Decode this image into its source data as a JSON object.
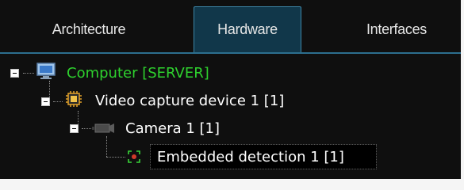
{
  "tabs": [
    {
      "label": "Architecture",
      "active": false
    },
    {
      "label": "Hardware",
      "active": true
    },
    {
      "label": "Interfaces",
      "active": false
    }
  ],
  "tree": {
    "computer": {
      "label": "Computer [SERVER]",
      "color": "#2ed12e",
      "icon": "monitor-icon"
    },
    "video_device": {
      "label": "Video capture device 1 [1]",
      "icon": "chip-icon"
    },
    "camera": {
      "label": "Camera 1 [1]",
      "icon": "camera-icon"
    },
    "detection": {
      "label": "Embedded detection 1 [1]",
      "icon": "detection-icon",
      "selected": true
    }
  },
  "colors": {
    "background": "#0f0f0f",
    "active_tab": "#11374a",
    "active_tab_border": "#3d86a8",
    "computer_text": "#2ed12e"
  }
}
